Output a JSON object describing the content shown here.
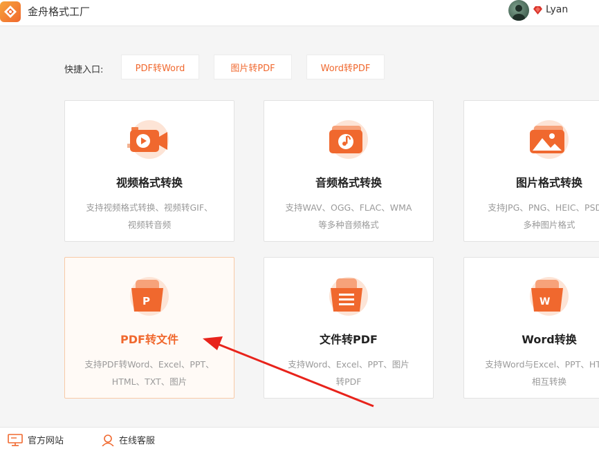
{
  "app": {
    "title": "金舟格式工厂"
  },
  "user": {
    "name": "Lyan"
  },
  "quick_access": {
    "label": "快捷入口:",
    "buttons": [
      "PDF转Word",
      "图片转PDF",
      "Word转PDF"
    ]
  },
  "cards": [
    {
      "title": "视频格式转换",
      "desc": [
        "支持视频格式转换、视频转GIF、",
        "视频转音频"
      ],
      "icon": "video-camera-icon"
    },
    {
      "title": "音频格式转换",
      "desc": [
        "支持WAV、OGG、FLAC、WMA",
        "等多种音频格式"
      ],
      "icon": "music-note-icon"
    },
    {
      "title": "图片格式转换",
      "desc": [
        "支持JPG、PNG、HEIC、PSD等",
        "多种图片格式"
      ],
      "icon": "image-icon"
    },
    {
      "title": "PDF转文件",
      "desc": [
        "支持PDF转Word、Excel、PPT、",
        "HTML、TXT、图片"
      ],
      "icon": "pdf-file-icon"
    },
    {
      "title": "文件转PDF",
      "desc": [
        "支持Word、Excel、PPT、图片",
        "转PDF"
      ],
      "icon": "document-icon"
    },
    {
      "title": "Word转换",
      "desc": [
        "支持Word与Excel、PPT、HTML",
        "相互转换"
      ],
      "icon": "word-file-icon"
    }
  ],
  "footer": {
    "official_site": "官方网站",
    "online_service": "在线客服"
  },
  "colors": {
    "accent": "#f0682e",
    "accent_light": "#f7a43c"
  }
}
